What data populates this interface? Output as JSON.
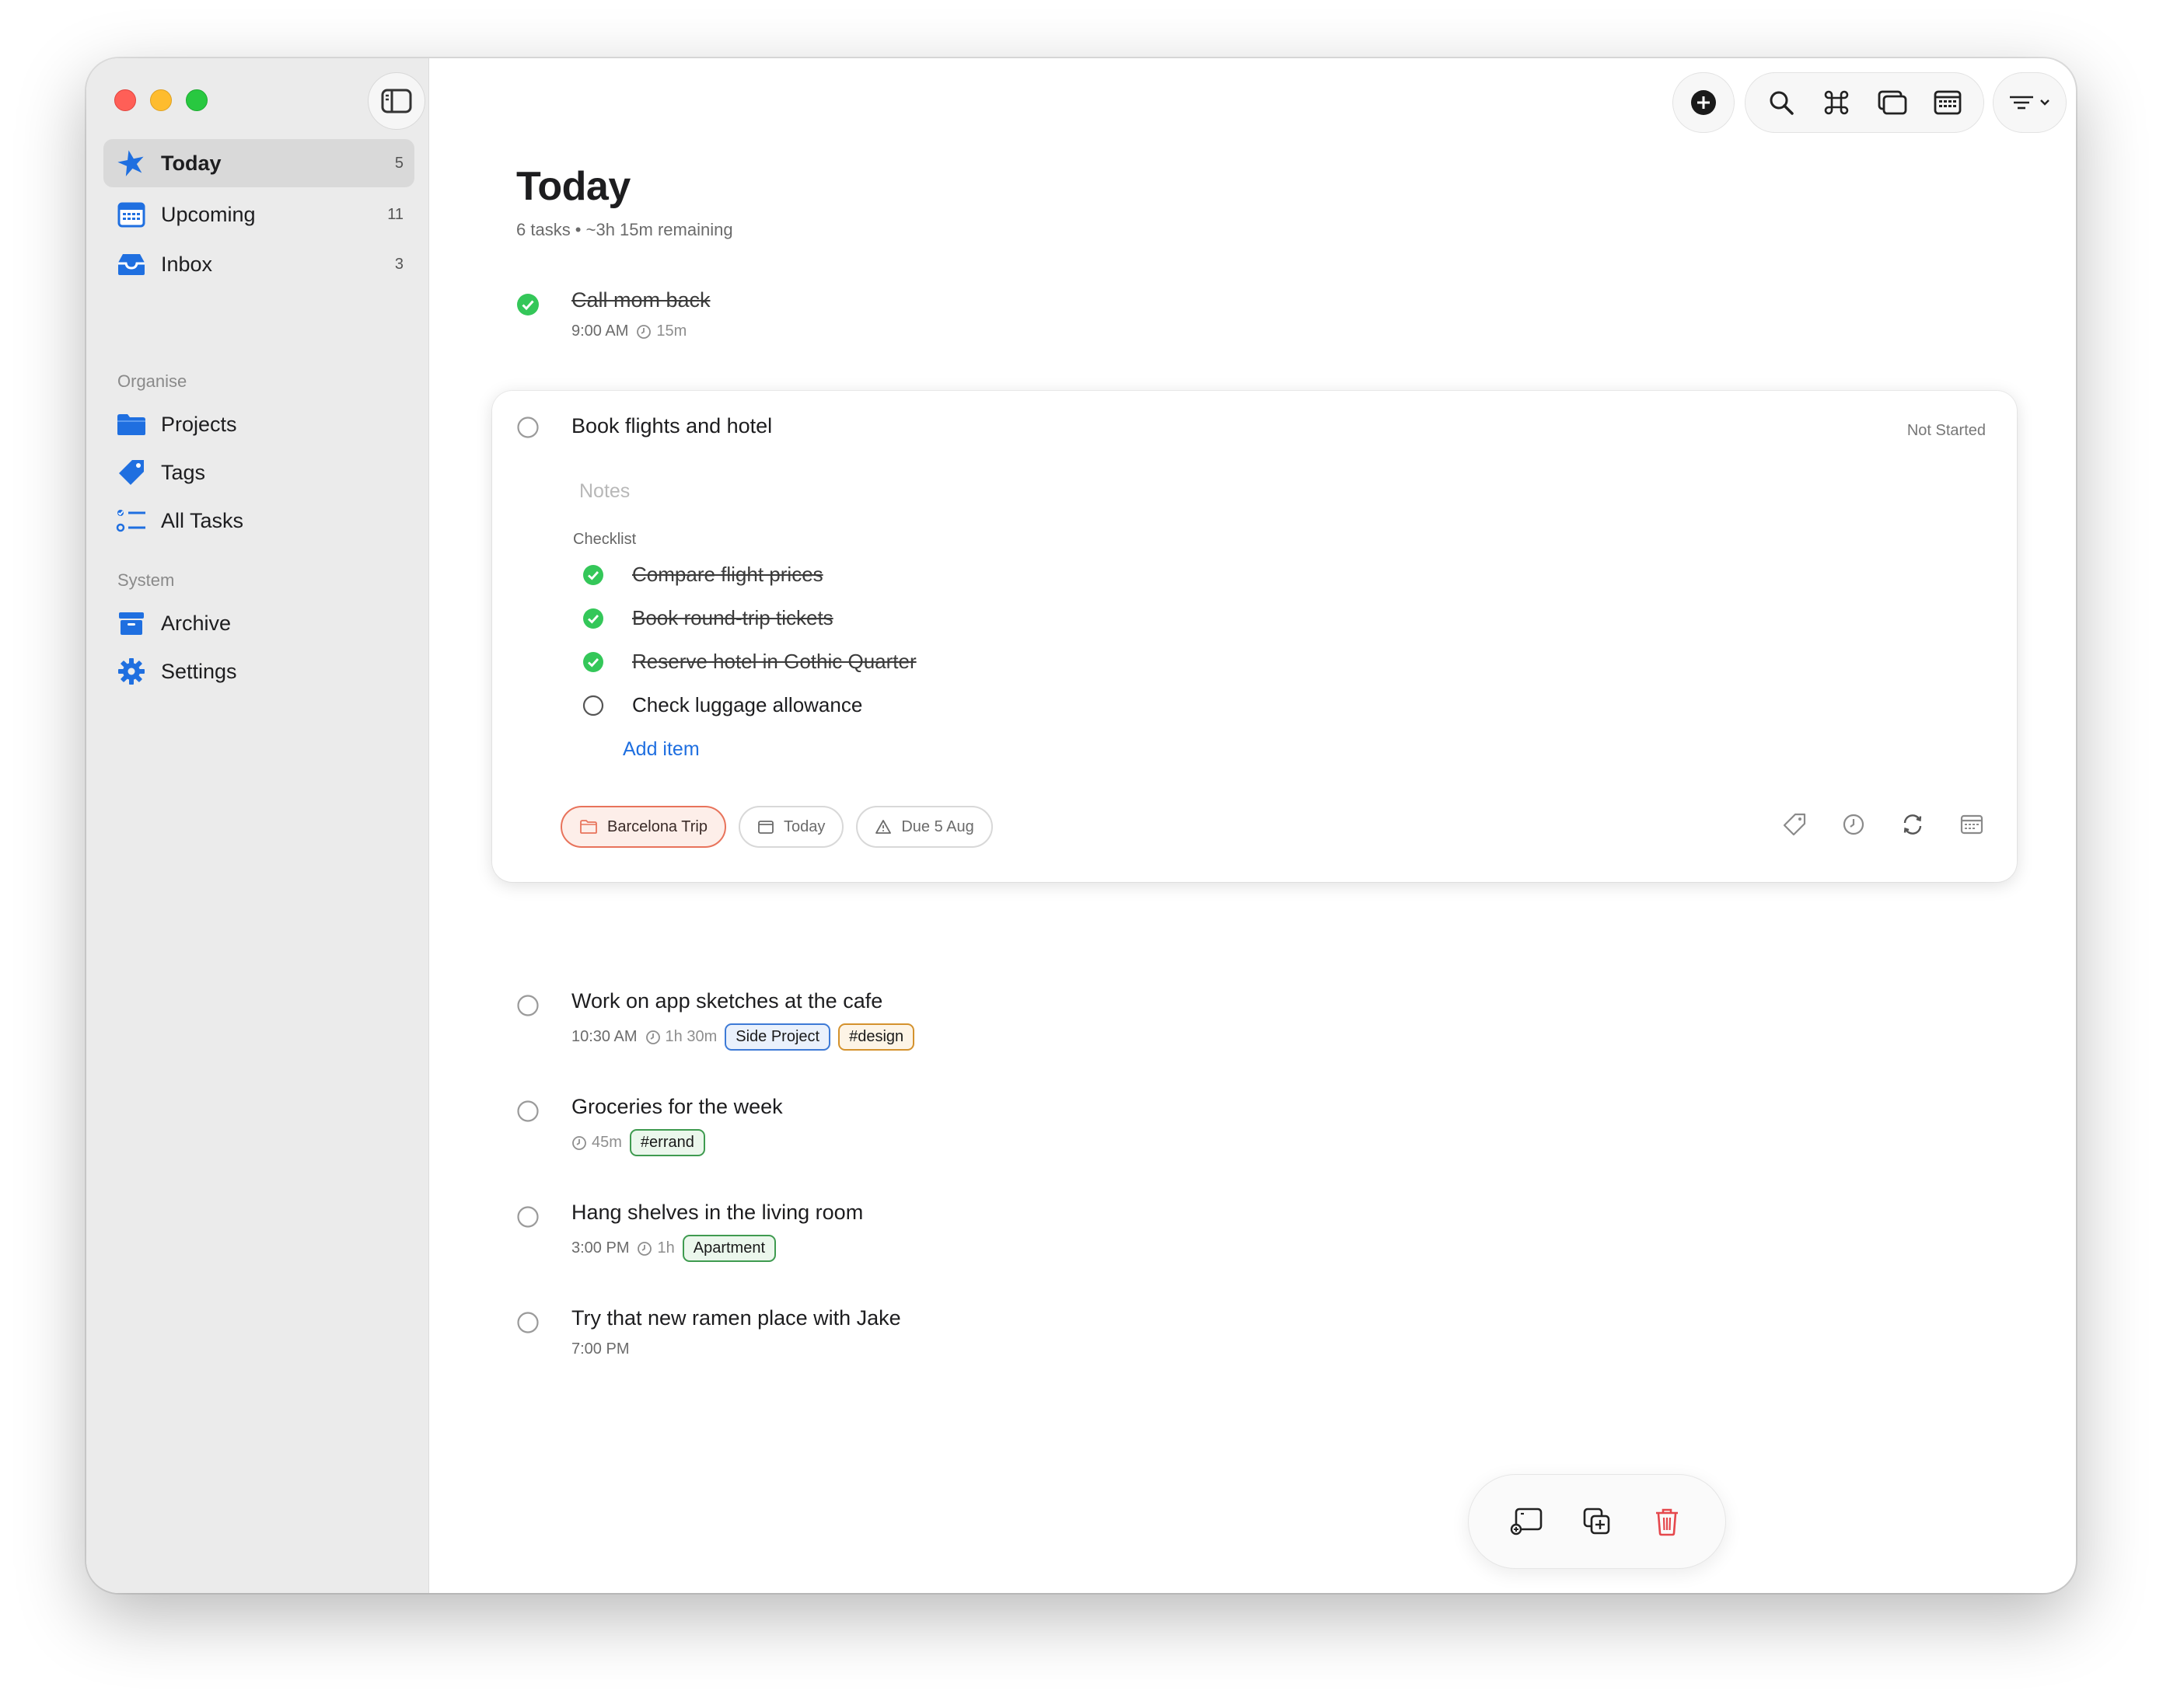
{
  "sidebar": {
    "items": [
      {
        "label": "Today",
        "count": "5",
        "icon": "star-icon",
        "color": "#1f6fe0"
      },
      {
        "label": "Upcoming",
        "count": "11",
        "icon": "calendar-icon",
        "color": "#1f6fe0"
      },
      {
        "label": "Inbox",
        "count": "3",
        "icon": "inbox-tray-icon",
        "color": "#1f6fe0"
      }
    ],
    "organise_label": "Organise",
    "organise_items": [
      {
        "label": "Projects",
        "icon": "folder-icon"
      },
      {
        "label": "Tags",
        "icon": "tag-icon"
      },
      {
        "label": "All Tasks",
        "icon": "list-icon"
      }
    ],
    "system_label": "System",
    "system_items": [
      {
        "label": "Archive",
        "icon": "archive-box-icon"
      },
      {
        "label": "Settings",
        "icon": "gear-icon"
      }
    ]
  },
  "header": {
    "title": "Today",
    "subtitle": "6 tasks • ~3h 15m remaining"
  },
  "tasks": [
    {
      "title": "Call mom back",
      "time": "9:00 AM",
      "duration": "15m",
      "completed": true
    },
    {
      "title": "Book flights and hotel",
      "status": "Not Started",
      "expanded": true
    },
    {
      "title": "Work on app sketches at the cafe",
      "time": "10:30 AM",
      "duration": "1h 30m",
      "tags": [
        "Side Project",
        "#design"
      ]
    },
    {
      "title": "Groceries for the week",
      "duration": "45m",
      "tags": [
        "#errand"
      ]
    },
    {
      "title": "Hang shelves in the living room",
      "time": "3:00 PM",
      "duration": "1h",
      "tags": [
        "Apartment"
      ]
    },
    {
      "title": "Try that new ramen place with Jake",
      "time": "7:00 PM"
    }
  ],
  "detail": {
    "notes_placeholder": "Notes",
    "checklist_label": "Checklist",
    "checklist": [
      {
        "label": "Compare flight prices",
        "done": true
      },
      {
        "label": "Book round-trip tickets",
        "done": true
      },
      {
        "label": "Reserve hotel in Gothic Quarter",
        "done": true
      },
      {
        "label": "Check luggage allowance",
        "done": false
      }
    ],
    "add_item_label": "Add item",
    "project_chip": "Barcelona Trip",
    "date_chip": "Today",
    "due_chip": "Due 5 Aug"
  },
  "colors": {
    "accent": "#1f6fe0",
    "complete_green": "#34c759",
    "delete_red": "#e5484d",
    "project_chip": "#e8735b"
  }
}
